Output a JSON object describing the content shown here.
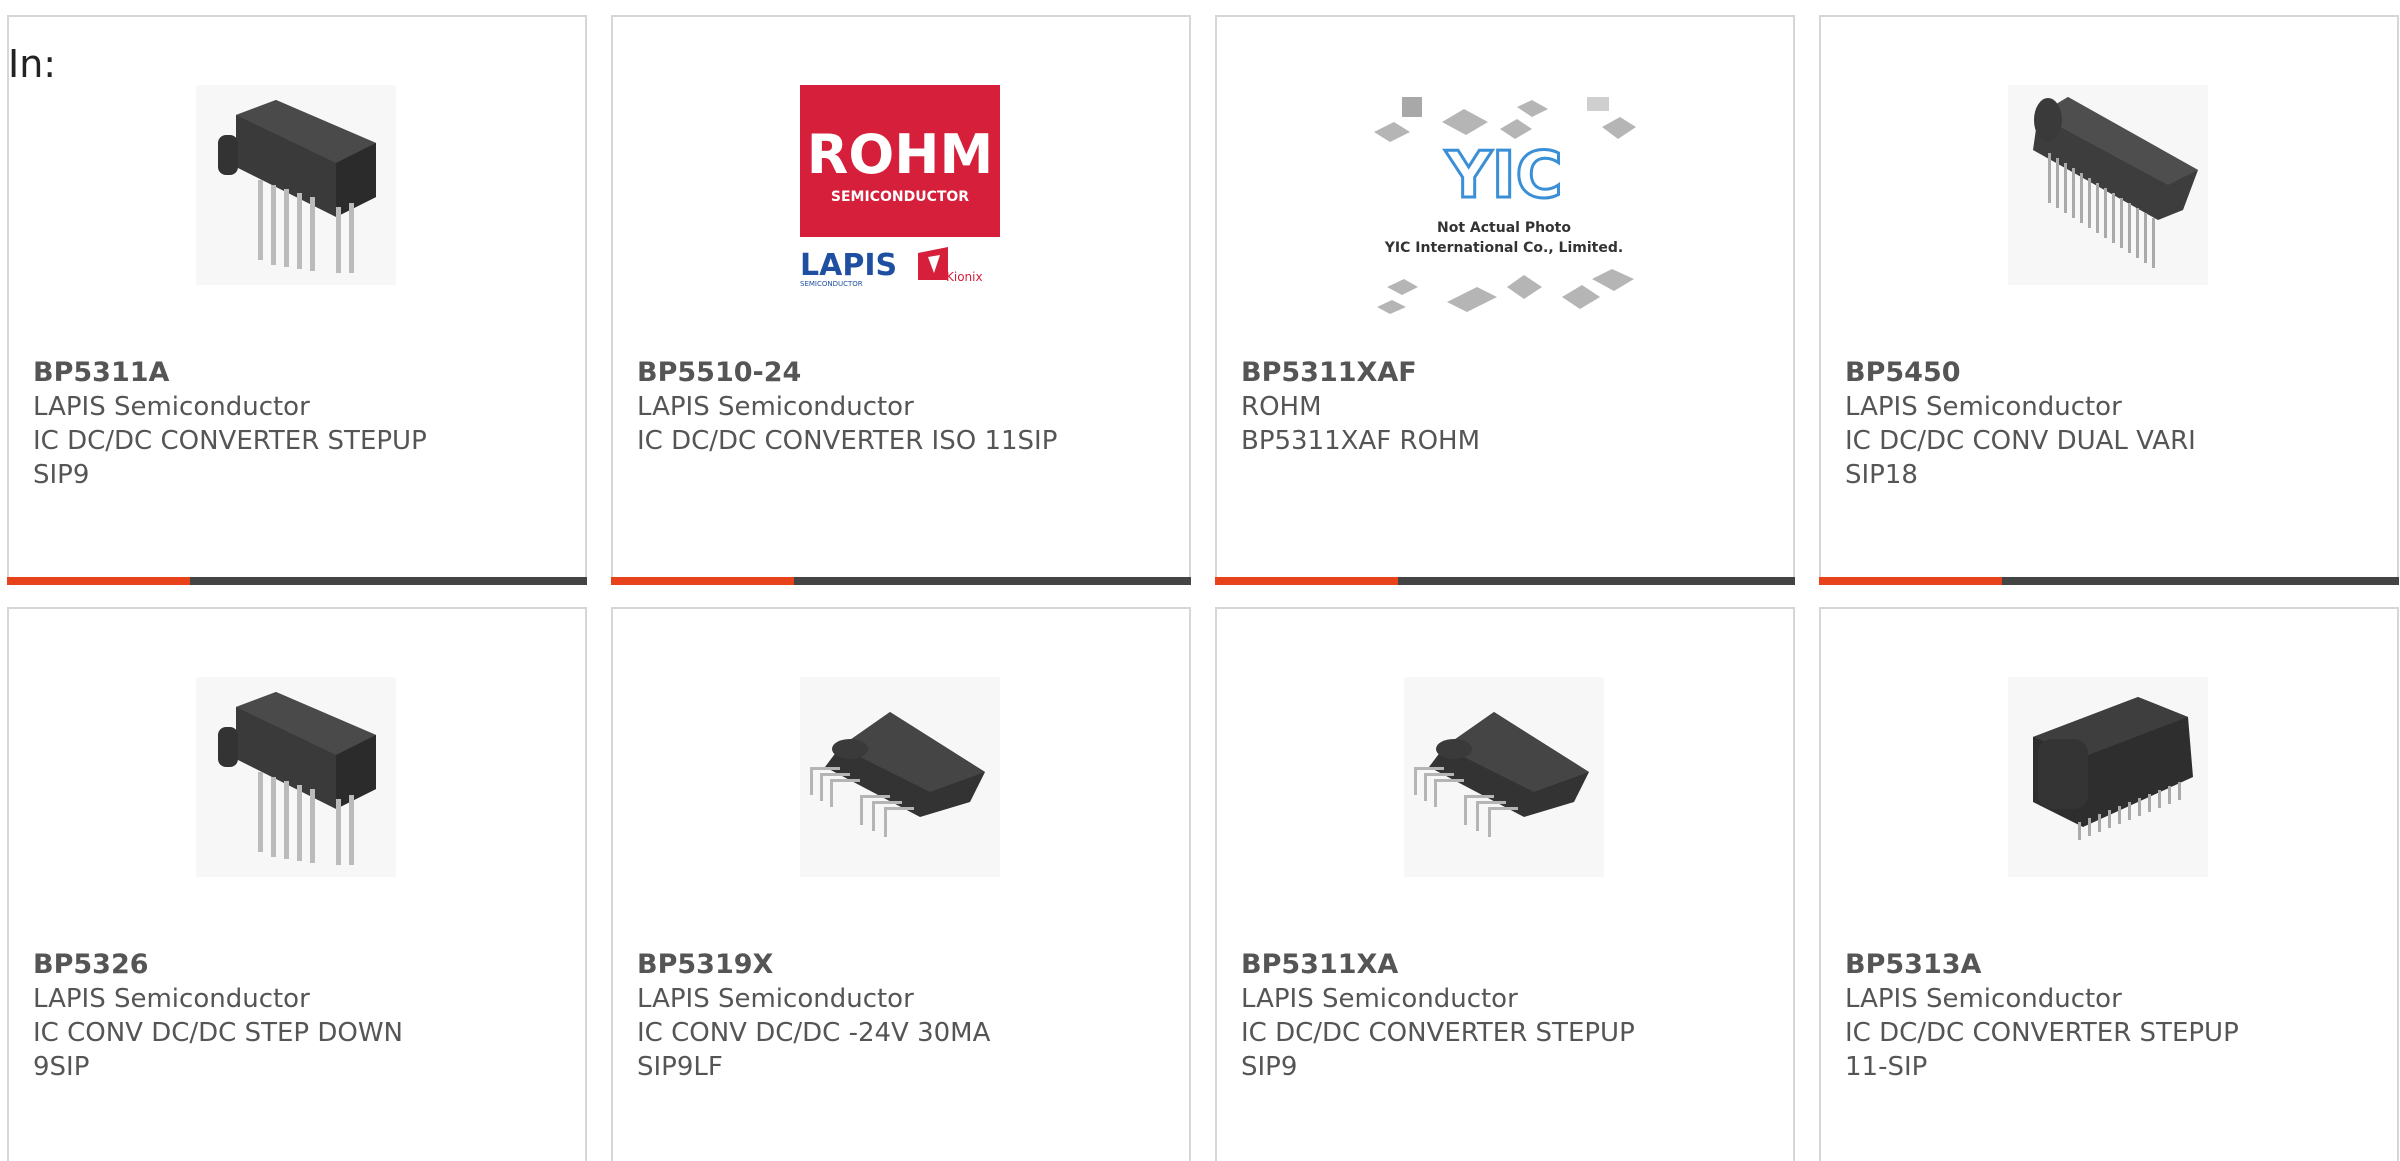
{
  "header": {
    "label": "In:"
  },
  "products": [
    {
      "part": "BP5311A",
      "manufacturer": "LAPIS Semiconductor",
      "description": "IC DC/DC CONVERTER STEPUP",
      "package": "SIP9",
      "image": "sip-module-angled-photo"
    },
    {
      "part": "BP5510-24",
      "manufacturer": "LAPIS Semiconductor",
      "description": "IC DC/DC CONVERTER ISO 11SIP",
      "package": "",
      "image": "rohm-lapis-kionix-logo",
      "logo": {
        "brand": "ROHM",
        "tagline": "SEMICONDUCTOR",
        "sub1": "LAPIS",
        "sub1_tagline": "SEMICONDUCTOR",
        "sub2": "Kionix",
        "brand_color": "#d61f3a",
        "sub1_color": "#1f4fa0",
        "sub2_color": "#d61f3a"
      }
    },
    {
      "part": "BP5311XAF",
      "manufacturer": "ROHM",
      "description": "BP5311XAF ROHM",
      "package": "",
      "image": "yic-placeholder",
      "placeholder": {
        "logo": "YIC",
        "line1": "Not Actual Photo",
        "line2": "YIC International Co., Limited."
      }
    },
    {
      "part": "BP5450",
      "manufacturer": "LAPIS Semiconductor",
      "description": "IC DC/DC CONV DUAL VARI",
      "package": "SIP18",
      "image": "sip18-module-photo"
    },
    {
      "part": "BP5326",
      "manufacturer": "LAPIS Semiconductor",
      "description": "IC CONV DC/DC STEP DOWN",
      "package": "9SIP",
      "image": "sip-module-angled-photo"
    },
    {
      "part": "BP5319X",
      "manufacturer": "LAPIS Semiconductor",
      "description": "IC CONV DC/DC -24V 30MA",
      "package": "SIP9LF",
      "image": "sip-flat-module-photo"
    },
    {
      "part": "BP5311XA",
      "manufacturer": "LAPIS Semiconductor",
      "description": "IC DC/DC CONVERTER STEPUP",
      "package": "SIP9",
      "image": "sip-flat-module-photo"
    },
    {
      "part": "BP5313A",
      "manufacturer": "LAPIS Semiconductor",
      "description": "IC DC/DC CONVERTER STEPUP",
      "package": "11-SIP",
      "image": "sip-box-module-photo"
    }
  ],
  "colors": {
    "accent": "#e8421a",
    "bar": "#444444",
    "text": "#555555",
    "border": "#d6d6d6"
  }
}
